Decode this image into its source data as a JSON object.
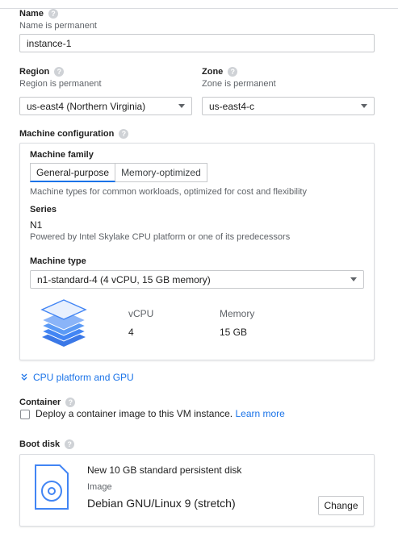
{
  "name": {
    "label": "Name",
    "hint": "Name is permanent",
    "value": "instance-1"
  },
  "region": {
    "label": "Region",
    "hint": "Region is permanent",
    "value": "us-east4 (Northern Virginia)"
  },
  "zone": {
    "label": "Zone",
    "hint": "Zone is permanent",
    "value": "us-east4-c"
  },
  "machine": {
    "label": "Machine configuration",
    "family_label": "Machine family",
    "tabs": [
      "General-purpose",
      "Memory-optimized"
    ],
    "family_desc": "Machine types for common workloads, optimized for cost and flexibility",
    "series_label": "Series",
    "series_value": "N1",
    "series_desc": "Powered by Intel Skylake CPU platform or one of its predecessors",
    "type_label": "Machine type",
    "type_value": "n1-standard-4 (4 vCPU, 15 GB memory)",
    "vcpu_header": "vCPU",
    "vcpu_value": "4",
    "memory_header": "Memory",
    "memory_value": "15 GB"
  },
  "cpu_link": "CPU platform and GPU",
  "container": {
    "label": "Container",
    "checkbox_text": "Deploy a container image to this VM instance.",
    "learn_more": "Learn more"
  },
  "boot": {
    "label": "Boot disk",
    "disk_title": "New 10 GB standard persistent disk",
    "image_label": "Image",
    "image_value": "Debian GNU/Linux 9 (stretch)",
    "change_button": "Change"
  },
  "help_glyph": "?",
  "icons": {
    "help": "help-circle-icon",
    "layers": "layers-icon",
    "disk": "disk-icon",
    "chevron": "chevron-down-icon"
  },
  "colors": {
    "accent": "#1a73e8",
    "layers": "#4285f4"
  }
}
